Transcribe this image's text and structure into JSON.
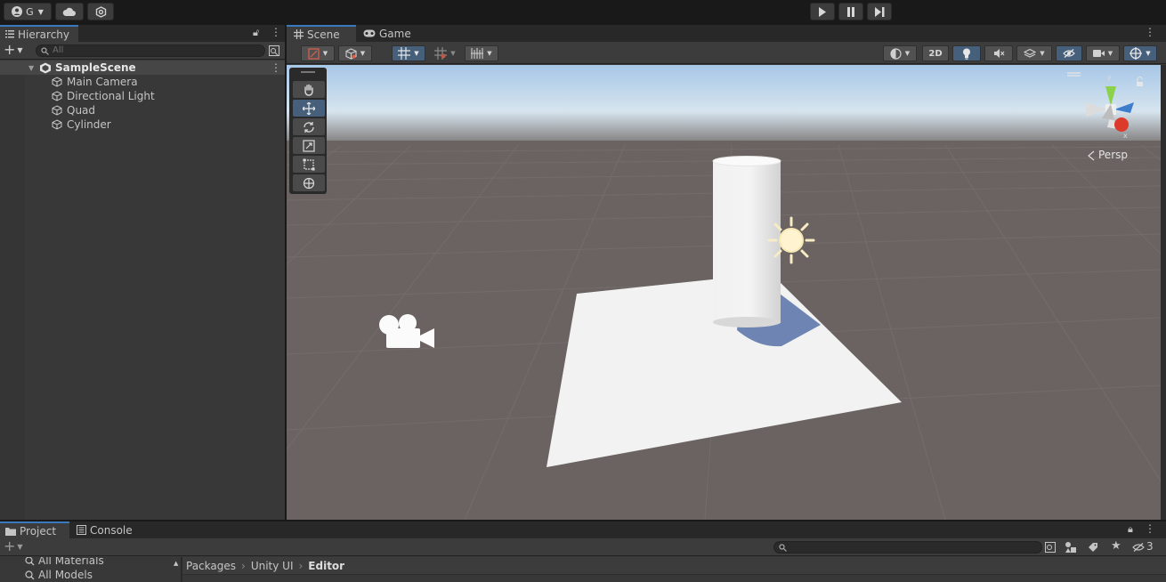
{
  "topbar": {
    "account_label": "G",
    "play_icon": "play-icon",
    "pause_icon": "pause-icon",
    "step_icon": "step-icon"
  },
  "hierarchy": {
    "tab_label": "Hierarchy",
    "search_placeholder": "All",
    "scene_name": "SampleScene",
    "items": [
      {
        "label": "Main Camera"
      },
      {
        "label": "Directional Light"
      },
      {
        "label": "Quad"
      },
      {
        "label": "Cylinder"
      }
    ]
  },
  "scene_view": {
    "tabs": [
      {
        "label": "Scene",
        "icon": "grid-icon"
      },
      {
        "label": "Game",
        "icon": "gamepad-icon"
      }
    ],
    "mode_2d_label": "2D",
    "persp_label": "Persp",
    "gizmo_axes": {
      "y": "y",
      "x": "x"
    }
  },
  "bottom": {
    "tabs": [
      {
        "label": "Project",
        "icon": "folder-icon"
      },
      {
        "label": "Console",
        "icon": "console-icon"
      }
    ],
    "left_items": [
      {
        "label": "All Materials"
      },
      {
        "label": "All Models"
      }
    ],
    "breadcrumb": [
      "Packages",
      "Unity UI",
      "Editor"
    ],
    "hidden_count": "3"
  },
  "colors": {
    "accent": "#3a79bb",
    "panel": "#383838",
    "toolbar": "#3c3c3c",
    "tab_strip": "#282828"
  }
}
